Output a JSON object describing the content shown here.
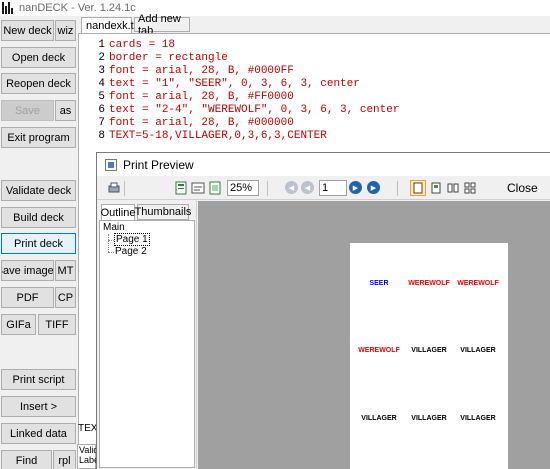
{
  "titlebar": {
    "title": "nanDECK - Ver. 1.24.1c"
  },
  "buttons": {
    "new_deck": "New deck",
    "wiz": "wiz",
    "open_deck": "Open deck",
    "reopen_deck": "Reopen deck",
    "save": "Save",
    "save_as": "as",
    "exit_program": "Exit program",
    "validate_deck": "Validate deck",
    "build_deck": "Build deck",
    "print_deck": "Print deck",
    "save_images": "Save images",
    "mt": "MT",
    "pdf": "PDF",
    "cp": "CP",
    "gifa": "GIFa",
    "tiff": "TIFF",
    "print_script": "Print script",
    "insert": "Insert >",
    "linked_data": "Linked data",
    "find": "Find",
    "rpl": "rpl"
  },
  "editor": {
    "tabs": {
      "active": "nandexk.txt",
      "add": "Add new tab"
    },
    "lines": [
      {
        "num": "1",
        "parts": [
          {
            "t": "cards = 18",
            "c": "kw"
          }
        ]
      },
      {
        "num": "2",
        "parts": [
          {
            "t": "border = rectangle",
            "c": "kw"
          }
        ]
      },
      {
        "num": "3",
        "parts": [
          {
            "t": "font = arial, 28, B, #0000FF",
            "c": "kw"
          }
        ]
      },
      {
        "num": "4",
        "parts": [
          {
            "t": "text = ",
            "c": "kw"
          },
          {
            "t": "\"1\", \"SEER\", 0, 3, 6, 3, center",
            "c": "kw"
          }
        ]
      },
      {
        "num": "5",
        "parts": [
          {
            "t": "font = arial, 28, B, #FF0000",
            "c": "kw"
          }
        ]
      },
      {
        "num": "6",
        "parts": [
          {
            "t": "text = ",
            "c": "kw"
          },
          {
            "t": "\"2-4\", \"WEREWOLF\", 0, 3, 6, 3, center",
            "c": "kw"
          }
        ]
      },
      {
        "num": "7",
        "parts": [
          {
            "t": "font = arial, 28, B, #000000",
            "c": "kw"
          }
        ]
      },
      {
        "num": "8",
        "parts": [
          {
            "t": "TEXT=",
            "c": "kw"
          },
          {
            "t": "5-18,VILLAGER,0,3,6,3,CENTER",
            "c": "kw"
          }
        ]
      }
    ],
    "side_labels": {
      "text": "TEXT",
      "valid": "Valid",
      "label": "Labe"
    }
  },
  "print_preview": {
    "title": "Print Preview",
    "zoom": "25%",
    "page_number": "1",
    "close_label": "Close",
    "tabs": {
      "outline": "Outline",
      "thumbnails": "Thumbnails"
    },
    "tree": {
      "root": "Main",
      "pages": [
        "Page 1",
        "Page 2"
      ]
    },
    "cards": [
      {
        "text": "SEER",
        "color": "#0000FF"
      },
      {
        "text": "WEREWOLF",
        "color": "#FF0000"
      },
      {
        "text": "WEREWOLF",
        "color": "#FF0000"
      },
      {
        "text": "WEREWOLF",
        "color": "#FF0000"
      },
      {
        "text": "VILLAGER",
        "color": "#000000"
      },
      {
        "text": "VILLAGER",
        "color": "#000000"
      },
      {
        "text": "VILLAGER",
        "color": "#000000"
      },
      {
        "text": "VILLAGER",
        "color": "#000000"
      },
      {
        "text": "VILLAGER",
        "color": "#000000"
      }
    ]
  },
  "colors": {
    "keyword": "#c00000",
    "accent": "#0078d7",
    "nav_blue": "#1e63b5",
    "nav_disabled": "#b9c3cf"
  },
  "icons": [
    "print-icon",
    "page-setup-icon",
    "export-icon",
    "copy-icon",
    "first-page-icon",
    "prev-page-icon",
    "next-page-icon",
    "last-page-icon",
    "single-page-icon",
    "two-page-icon",
    "book-icon",
    "multi-page-icon"
  ]
}
